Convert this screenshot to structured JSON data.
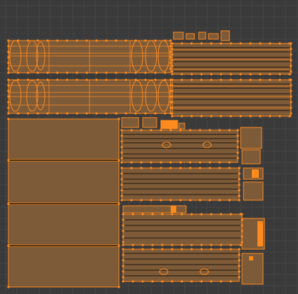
{
  "editor": "uv-editor-viewport",
  "colors": {
    "background": "#3a3a3a",
    "grid_minor": "#444444",
    "grid_major": "#4d4d4d",
    "uv_face_fill": "#7d5a38",
    "uv_edge": "#ff8a1e",
    "uv_vertex": "#ff8a1e",
    "uv_inner_line": "#1f160d"
  }
}
